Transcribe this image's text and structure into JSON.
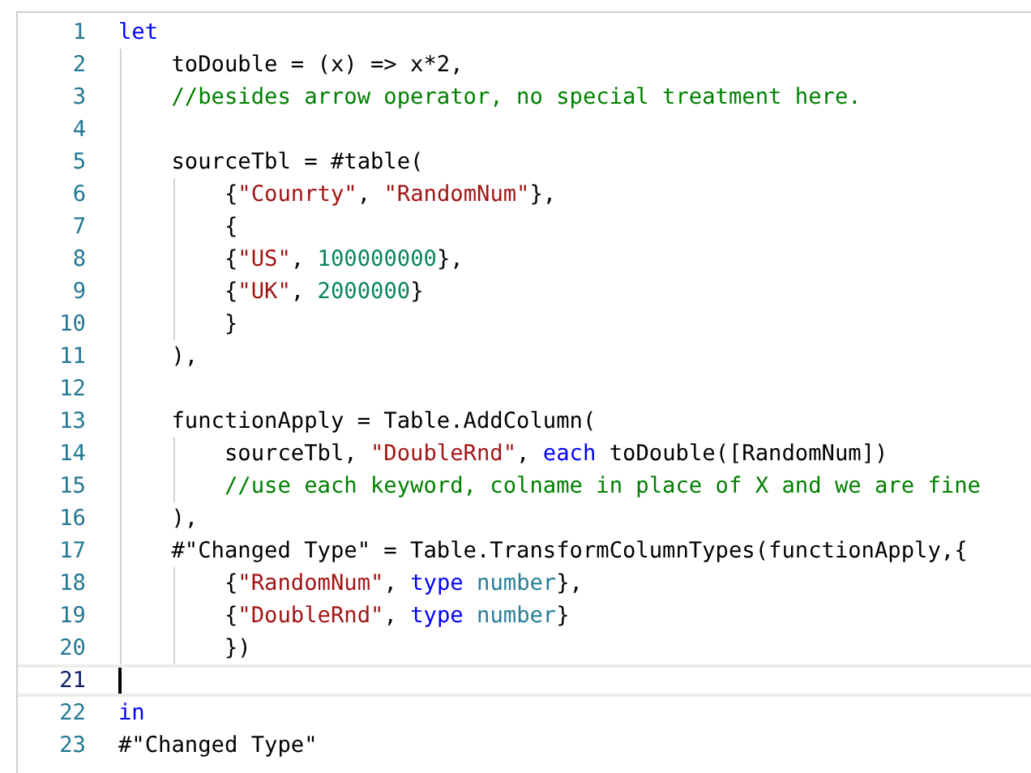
{
  "editor": {
    "lines": [
      {
        "number": "1",
        "current": false,
        "tokens": [
          {
            "kind": "keyword",
            "text": "let"
          }
        ]
      },
      {
        "number": "2",
        "current": false,
        "tokens": [
          {
            "kind": "plain",
            "text": "    toDouble = (x) => x*2,"
          }
        ]
      },
      {
        "number": "3",
        "current": false,
        "tokens": [
          {
            "kind": "comment",
            "text": "    //besides arrow operator, no special treatment here."
          }
        ]
      },
      {
        "number": "4",
        "current": false
      },
      {
        "number": "5",
        "current": false,
        "tokens": [
          {
            "kind": "plain",
            "text": "    sourceTbl = #table("
          }
        ]
      },
      {
        "number": "6",
        "current": false,
        "tokens": [
          {
            "kind": "plain",
            "text": "        {"
          },
          {
            "kind": "string",
            "text": "\"Counrty\""
          },
          {
            "kind": "plain",
            "text": ", "
          },
          {
            "kind": "string",
            "text": "\"RandomNum\""
          },
          {
            "kind": "plain",
            "text": "},"
          }
        ]
      },
      {
        "number": "7",
        "current": false,
        "tokens": [
          {
            "kind": "plain",
            "text": "        {"
          }
        ]
      },
      {
        "number": "8",
        "current": false,
        "tokens": [
          {
            "kind": "plain",
            "text": "        {"
          },
          {
            "kind": "string",
            "text": "\"US\""
          },
          {
            "kind": "plain",
            "text": ", "
          },
          {
            "kind": "number",
            "text": "100000000"
          },
          {
            "kind": "plain",
            "text": "},"
          }
        ]
      },
      {
        "number": "9",
        "current": false,
        "tokens": [
          {
            "kind": "plain",
            "text": "        {"
          },
          {
            "kind": "string",
            "text": "\"UK\""
          },
          {
            "kind": "plain",
            "text": ", "
          },
          {
            "kind": "number",
            "text": "2000000"
          },
          {
            "kind": "plain",
            "text": "}"
          }
        ]
      },
      {
        "number": "10",
        "current": false,
        "tokens": [
          {
            "kind": "plain",
            "text": "        }"
          }
        ]
      },
      {
        "number": "11",
        "current": false,
        "tokens": [
          {
            "kind": "plain",
            "text": "    ),"
          }
        ]
      },
      {
        "number": "12",
        "current": false
      },
      {
        "number": "13",
        "current": false,
        "tokens": [
          {
            "kind": "plain",
            "text": "    functionApply = Table.AddColumn("
          }
        ]
      },
      {
        "number": "14",
        "current": false,
        "tokens": [
          {
            "kind": "plain",
            "text": "        sourceTbl, "
          },
          {
            "kind": "string",
            "text": "\"DoubleRnd\""
          },
          {
            "kind": "plain",
            "text": ", "
          },
          {
            "kind": "keyword",
            "text": "each"
          },
          {
            "kind": "plain",
            "text": " toDouble([RandomNum])"
          }
        ]
      },
      {
        "number": "15",
        "current": false,
        "tokens": [
          {
            "kind": "comment",
            "text": "        //use each keyword, colname in place of X and we are fine"
          }
        ]
      },
      {
        "number": "16",
        "current": false,
        "tokens": [
          {
            "kind": "plain",
            "text": "    ),"
          }
        ]
      },
      {
        "number": "17",
        "current": false,
        "tokens": [
          {
            "kind": "plain",
            "text": "    #\"Changed Type\" = Table.TransformColumnTypes(functionApply,{"
          }
        ]
      },
      {
        "number": "18",
        "current": false,
        "tokens": [
          {
            "kind": "plain",
            "text": "        {"
          },
          {
            "kind": "string",
            "text": "\"RandomNum\""
          },
          {
            "kind": "plain",
            "text": ", "
          },
          {
            "kind": "keyword",
            "text": "type"
          },
          {
            "kind": "typename",
            "text": " number"
          },
          {
            "kind": "plain",
            "text": "},"
          }
        ]
      },
      {
        "number": "19",
        "current": false,
        "tokens": [
          {
            "kind": "plain",
            "text": "        {"
          },
          {
            "kind": "string",
            "text": "\"DoubleRnd\""
          },
          {
            "kind": "plain",
            "text": ", "
          },
          {
            "kind": "keyword",
            "text": "type"
          },
          {
            "kind": "typename",
            "text": " number"
          },
          {
            "kind": "plain",
            "text": "}"
          }
        ]
      },
      {
        "number": "20",
        "current": false,
        "tokens": [
          {
            "kind": "plain",
            "text": "        })"
          }
        ]
      },
      {
        "number": "21",
        "current": true
      },
      {
        "number": "22",
        "current": false,
        "tokens": [
          {
            "kind": "keyword",
            "text": "in"
          }
        ]
      },
      {
        "number": "23",
        "current": false,
        "tokens": [
          {
            "kind": "plain",
            "text": "#\"Changed Type\""
          }
        ]
      }
    ]
  }
}
